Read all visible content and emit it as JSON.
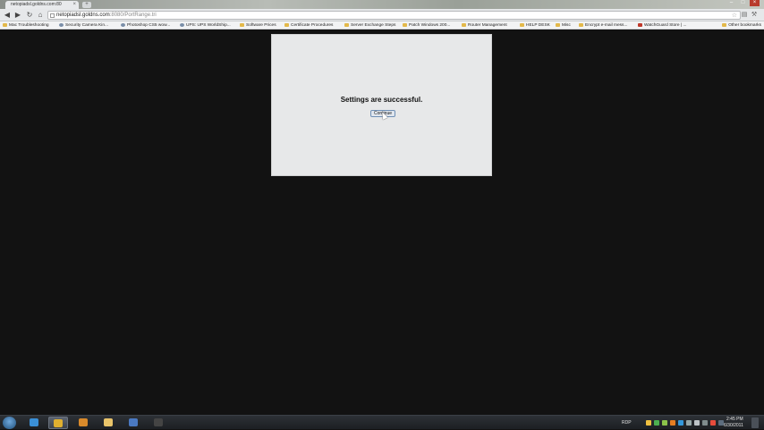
{
  "browser": {
    "tab_title": "netopiadsl.goldns.com:80",
    "tab_close": "×",
    "new_tab": "+",
    "url_host": "netopiadsl.goldns.com",
    "url_path": ":8080/PortRange.tri",
    "back_icon": "back-arrow-icon",
    "forward_icon": "forward-arrow-icon",
    "reload_icon": "reload-icon",
    "home_icon": "home-icon",
    "star_icon": "bookmark-star-icon",
    "wrench_icon": "wrench-icon"
  },
  "window_controls": {
    "minimize": "–",
    "maximize": "□",
    "close": "×"
  },
  "bookmarks": {
    "items": [
      {
        "label": "Mac Troubleshooting",
        "icon": "folder"
      },
      {
        "label": "Security Camera Kin...",
        "icon": "site"
      },
      {
        "label": "Photoshop CS5 wow...",
        "icon": "site"
      },
      {
        "label": "UPS: UPS WorldShip...",
        "icon": "site"
      },
      {
        "label": "Software Prices",
        "icon": "folder"
      },
      {
        "label": "Certificate Procedures",
        "icon": "folder"
      },
      {
        "label": "Server Exchange Steps",
        "icon": "folder"
      },
      {
        "label": "Patch Windows 200...",
        "icon": "folder"
      },
      {
        "label": "Router Management",
        "icon": "folder"
      },
      {
        "label": "HELP DESK",
        "icon": "folder"
      },
      {
        "label": "Misc",
        "icon": "folder"
      },
      {
        "label": "Encrypt e-mail mess...",
        "icon": "folder"
      },
      {
        "label": "WatchGuard Store | ...",
        "icon": "red"
      }
    ],
    "other": "Other bookmarks"
  },
  "page": {
    "message": "Settings are successful.",
    "button_label": "Continue"
  },
  "taskbar": {
    "apps": [
      {
        "name": "internet-explorer",
        "color": "#3a8fd6"
      },
      {
        "name": "chrome",
        "color": "#e0b030",
        "active": true
      },
      {
        "name": "media-player",
        "color": "#d98a2b"
      },
      {
        "name": "file-explorer",
        "color": "#e9c46a"
      },
      {
        "name": "outlook",
        "color": "#4a79c2"
      },
      {
        "name": "command-prompt",
        "color": "#444444"
      }
    ],
    "tray_label": "RDP",
    "time": "2:45 PM",
    "date": "6/30/2011"
  }
}
